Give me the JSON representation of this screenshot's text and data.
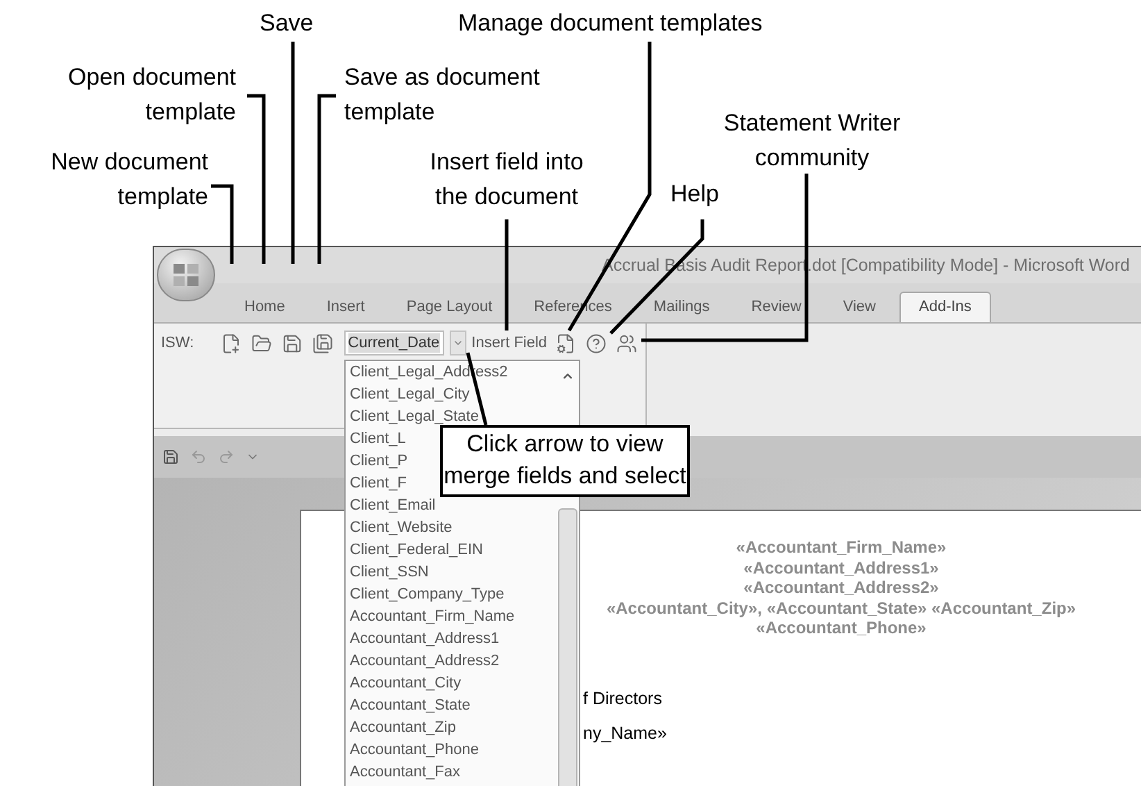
{
  "callouts": [
    {
      "text": "Save"
    },
    {
      "text": "Manage document templates"
    },
    {
      "text": "Open document\ntemplate"
    },
    {
      "text": "Save as document\ntemplate"
    },
    {
      "text": "Statement Writer\ncommunity"
    },
    {
      "text": "New document\ntemplate"
    },
    {
      "text": "Insert field into\nthe document"
    },
    {
      "text": "Help"
    }
  ],
  "instruction_callout": "Click arrow to view\nmerge fields and select",
  "window": {
    "title": "Accrual Basis Audit Report.dot [Compatibility Mode] - Microsoft Word",
    "tabs": [
      {
        "label": "Home",
        "selected": false
      },
      {
        "label": "Insert",
        "selected": false
      },
      {
        "label": "Page Layout",
        "selected": false
      },
      {
        "label": "References",
        "selected": false
      },
      {
        "label": "Mailings",
        "selected": false
      },
      {
        "label": "Review",
        "selected": false
      },
      {
        "label": "View",
        "selected": false
      },
      {
        "label": "Add-Ins",
        "selected": true
      }
    ],
    "ribbon": {
      "group_label": "ISW:",
      "field_combo": {
        "value": "Current_Date"
      },
      "insert_field": "Insert Field"
    },
    "field_list": {
      "items": [
        "Client_Legal_Address2",
        "Client_Legal_City",
        "Client_Legal_State",
        "Client_L",
        "Client_P",
        "Client_F",
        "Client_Email",
        "Client_Website",
        "Client_Federal_EIN",
        "Client_SSN",
        "Client_Company_Type",
        "Accountant_Firm_Name",
        "Accountant_Address1",
        "Accountant_Address2",
        "Accountant_City",
        "Accountant_State",
        "Accountant_Zip",
        "Accountant_Phone",
        "Accountant_Fax"
      ]
    },
    "document": {
      "header_lines": [
        "«Accountant_Firm_Name»",
        "«Accountant_Address1»",
        "«Accountant_Address2»",
        "«Accountant_City», «Accountant_State» «Accountant_Zip»",
        "«Accountant_Phone»"
      ],
      "body_lines": [
        "f Directors",
        "ny_Name»"
      ]
    }
  }
}
